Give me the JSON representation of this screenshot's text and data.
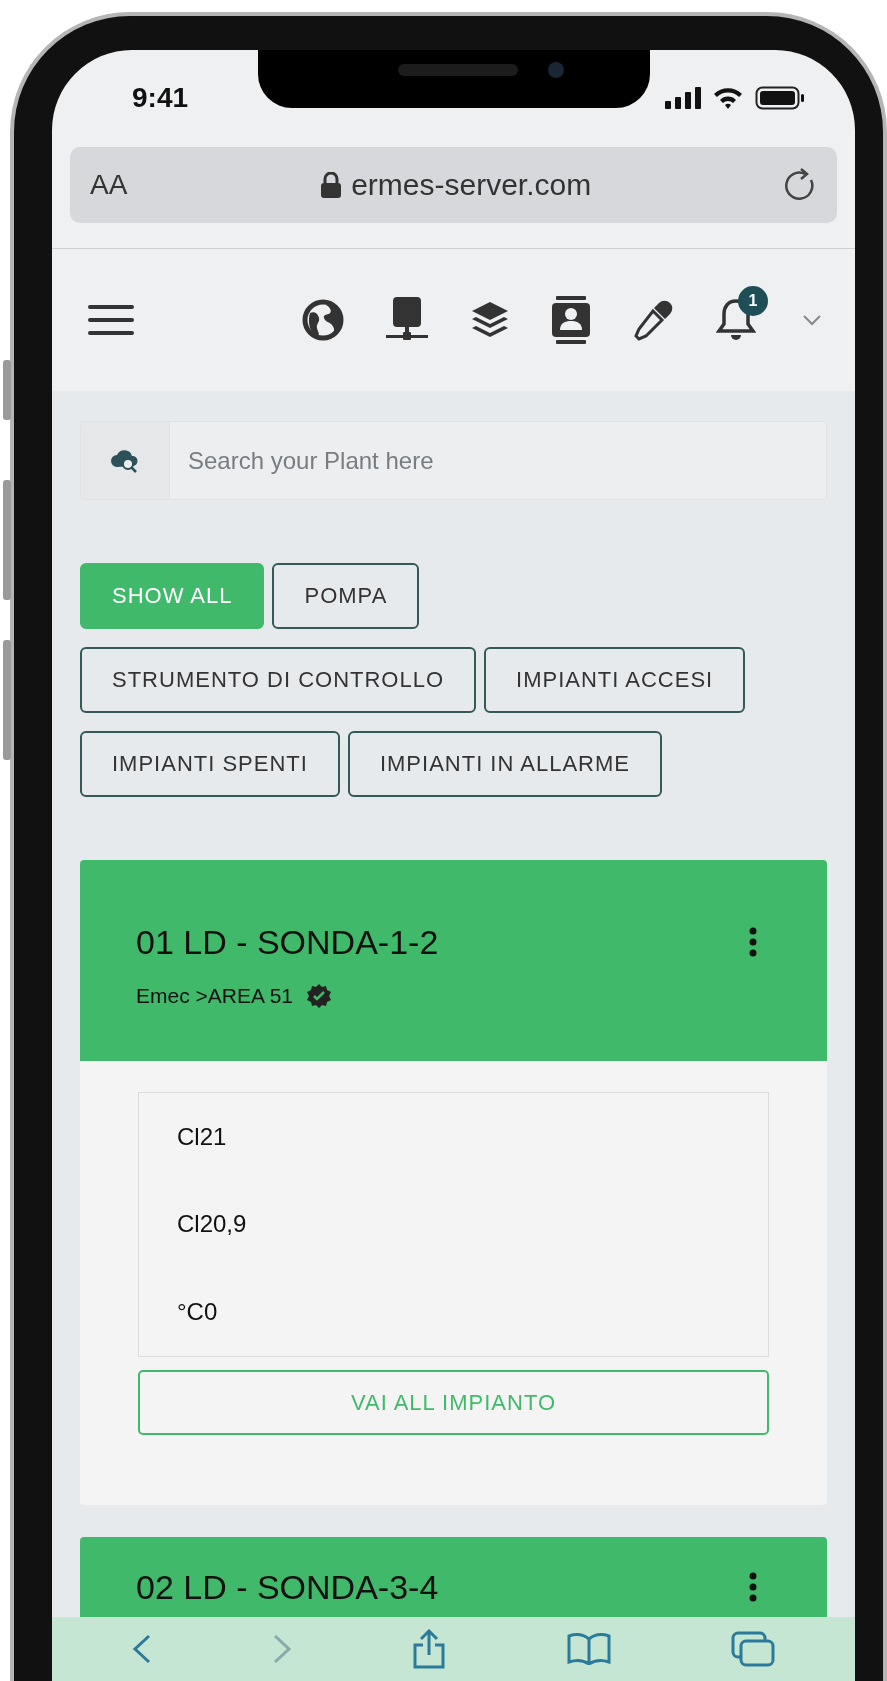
{
  "status_bar": {
    "time": "9:41"
  },
  "browser": {
    "text_size_button": "AA",
    "url": "ermes-server.com"
  },
  "nav": {
    "notification_count": "1"
  },
  "search": {
    "placeholder": "Search your Plant here"
  },
  "filters": {
    "rows": [
      [
        {
          "label": "SHOW ALL",
          "selected": true
        },
        {
          "label": "POMPA",
          "selected": false
        }
      ],
      [
        {
          "label": "STRUMENTO DI CONTROLLO",
          "selected": false
        },
        {
          "label": "IMPIANTI ACCESI",
          "selected": false
        }
      ],
      [
        {
          "label": "IMPIANTI SPENTI",
          "selected": false
        },
        {
          "label": "IMPIANTI IN ALLARME",
          "selected": false
        }
      ]
    ]
  },
  "plants": [
    {
      "title": "01 LD - SONDA-1-2",
      "location": "Emec >AREA 51",
      "verified": true,
      "readings": [
        "Cl21",
        "Cl20,9",
        "°C0"
      ],
      "action": "VAI ALL IMPIANTO"
    },
    {
      "title": "02 LD - SONDA-3-4"
    }
  ]
}
